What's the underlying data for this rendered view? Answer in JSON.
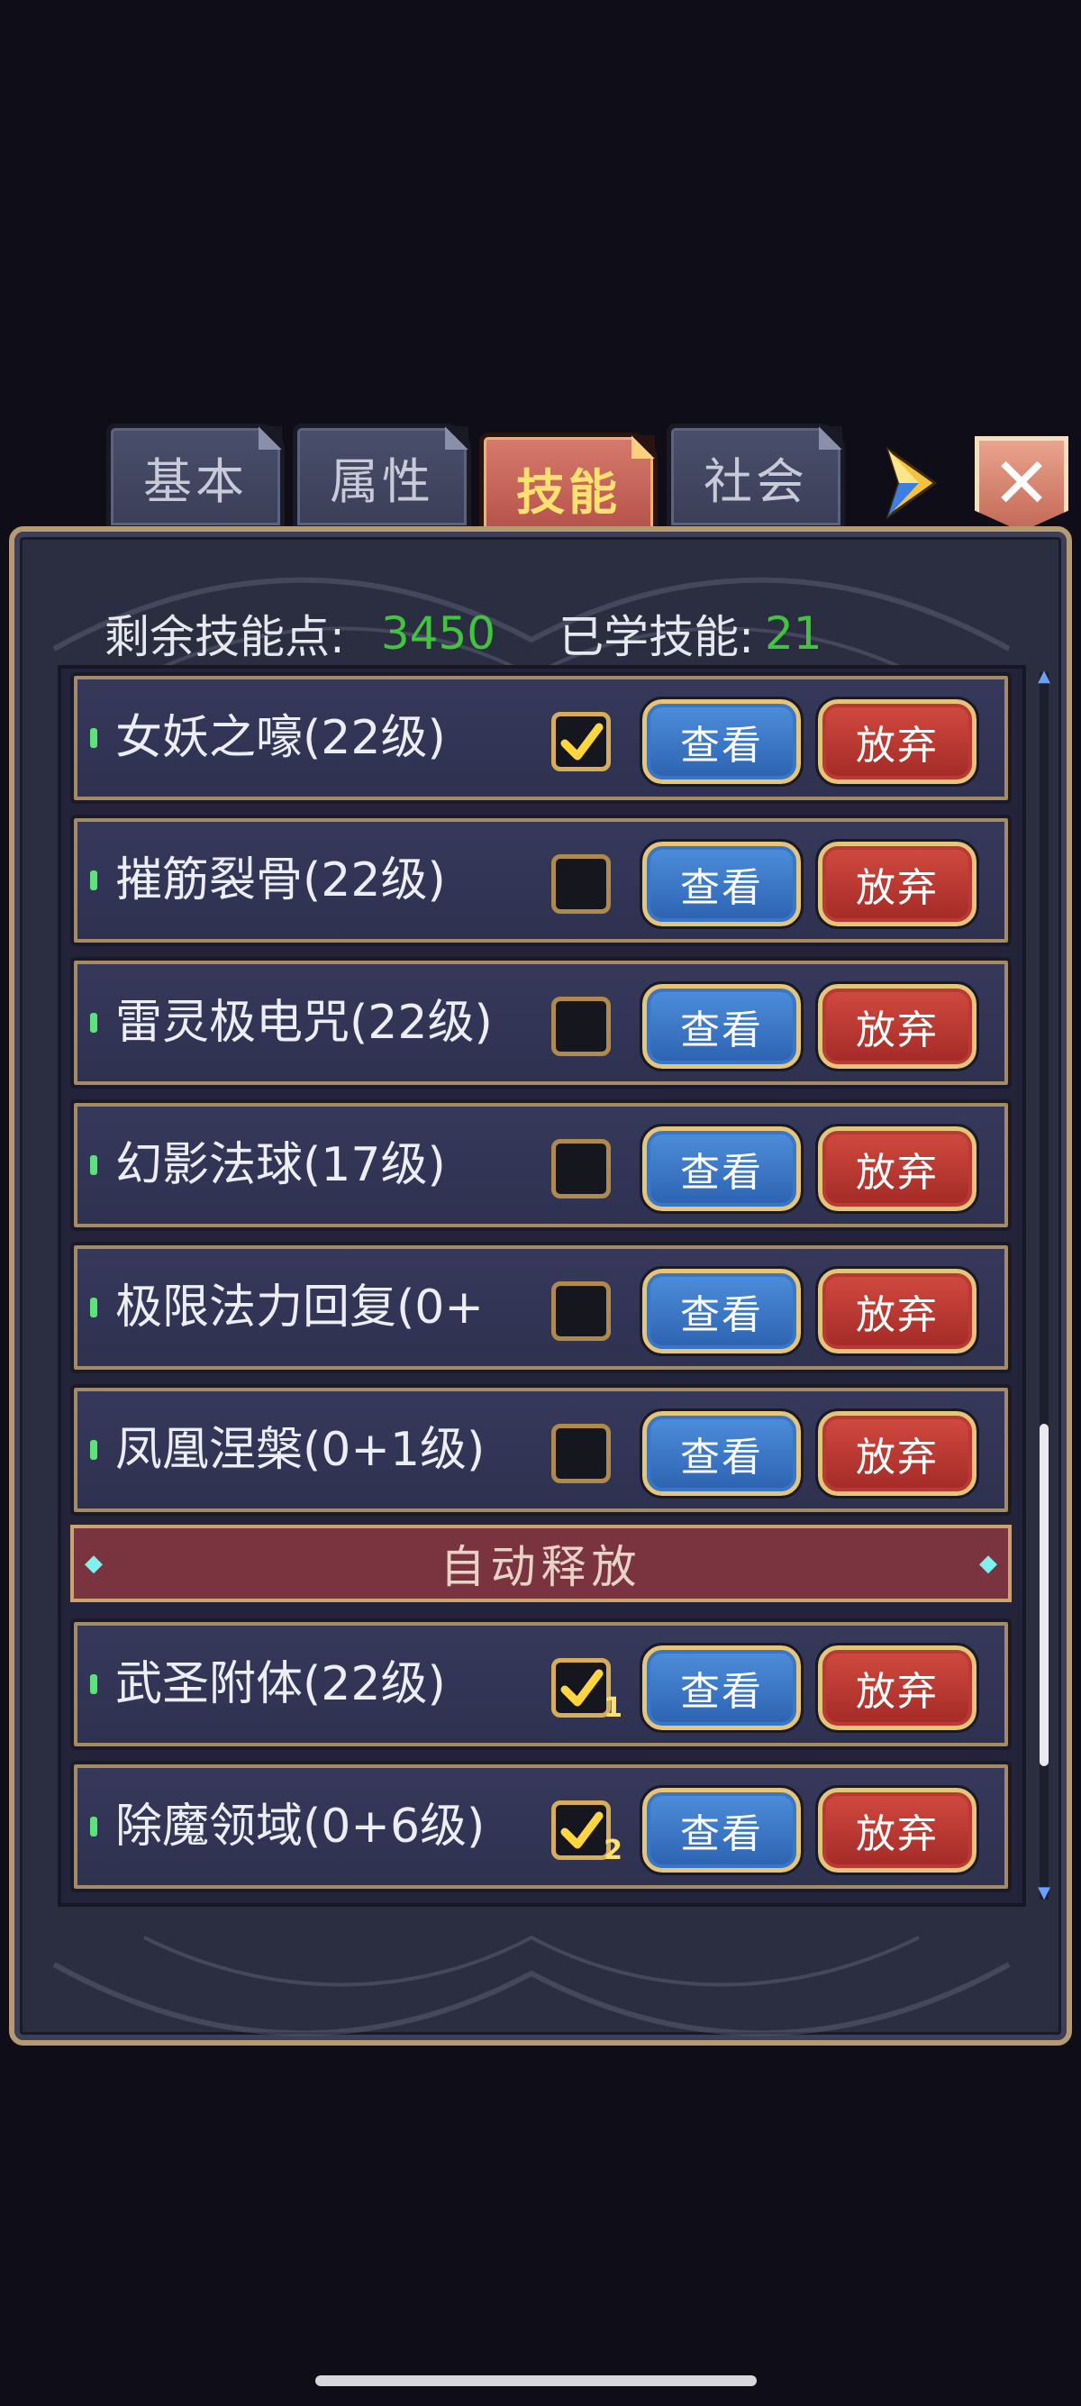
{
  "tabs": [
    {
      "label": "基本",
      "active": false
    },
    {
      "label": "属性",
      "active": false
    },
    {
      "label": "技能",
      "active": true
    },
    {
      "label": "社会",
      "active": false
    }
  ],
  "stats": {
    "remaining_label": "剩余技能点:",
    "remaining_value": "3450",
    "learned_label": "已学技能:",
    "learned_value": "21"
  },
  "buttons": {
    "view_label": "查看",
    "drop_label": "放弃",
    "close_label": "✕"
  },
  "skills": [
    {
      "name": "女妖之嚎(22级)",
      "checked": true,
      "slot": ""
    },
    {
      "name": "摧筋裂骨(22级)",
      "checked": false,
      "slot": ""
    },
    {
      "name": "雷灵极电咒(22级)",
      "checked": false,
      "slot": ""
    },
    {
      "name": "幻影法球(17级)",
      "checked": false,
      "slot": ""
    },
    {
      "name": "极限法力回复(0+",
      "checked": false,
      "slot": ""
    },
    {
      "name": "凤凰涅槃(0+1级)",
      "checked": false,
      "slot": ""
    }
  ],
  "section_title": "自动释放",
  "auto_skills": [
    {
      "name": "武圣附体(22级)",
      "checked": true,
      "slot": "1"
    },
    {
      "name": "除魔领域(0+6级)",
      "checked": true,
      "slot": "2"
    }
  ],
  "colors": {
    "background": "#0e0d18",
    "panel": "#2b2d41",
    "accent_gold": "#b79a72",
    "stat_number": "#43c43f",
    "active_tab": "#c85f55",
    "view_button": "#3a76c8",
    "drop_button": "#b83a32"
  },
  "icons": [
    "play-arrow-icon",
    "close-icon",
    "checkmark-icon",
    "scroll-up-icon",
    "scroll-down-icon"
  ]
}
